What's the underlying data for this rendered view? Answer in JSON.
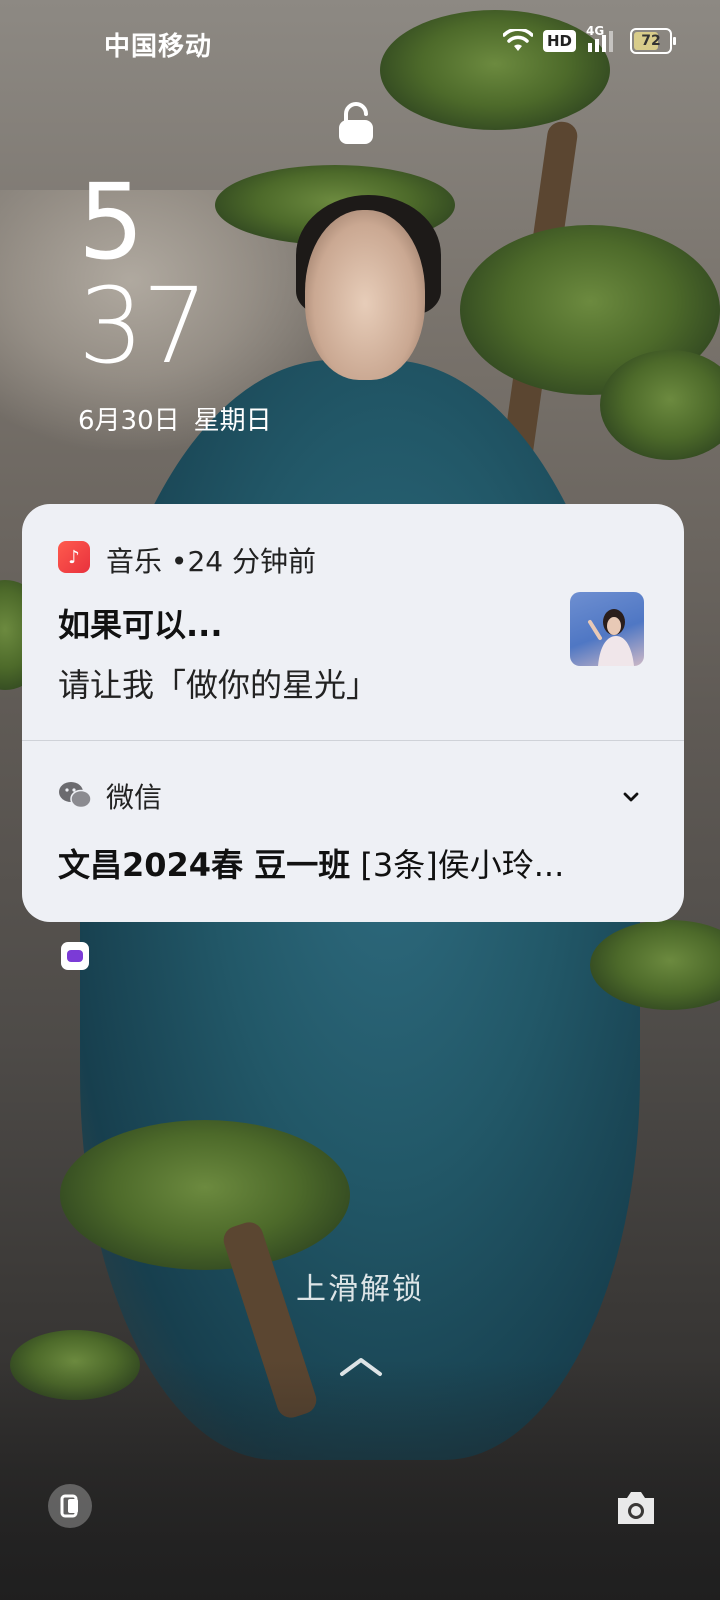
{
  "status_bar": {
    "carrier": "中国移动",
    "hd": "HD",
    "network": "4G",
    "battery": "72",
    "battery_level": 0.72
  },
  "lock": {
    "hours": "5",
    "minutes": "37",
    "date": "6月30日",
    "weekday": "星期日"
  },
  "notifications": {
    "music": {
      "app_name": "音乐",
      "separator": "•",
      "time": "24 分钟前",
      "title": "如果可以...",
      "body": "请让我「做你的星光」"
    },
    "wechat": {
      "app_name": "微信",
      "group": "文昌2024春 豆一班",
      "message": "[3条]侯小玲..."
    }
  },
  "swipe_hint": "上滑解锁",
  "icons": {
    "wifi": "wifi-icon",
    "signal": "signal-icon",
    "lock": "unlock-icon",
    "music_app": "music-note-icon",
    "wechat": "wechat-icon",
    "expand": "chevron-down-icon",
    "mini_app": "app-icon",
    "left_shortcut": "phone-shortcut-icon",
    "camera": "camera-icon"
  }
}
